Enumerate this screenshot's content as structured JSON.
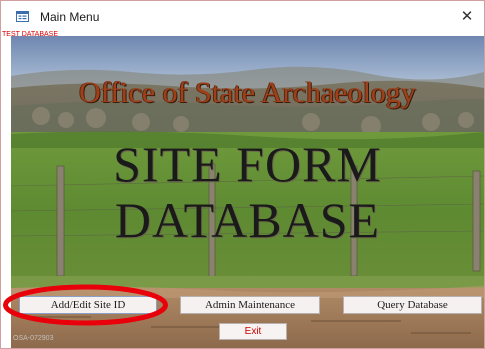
{
  "window": {
    "title": "Main Menu",
    "close_glyph": "✕",
    "icon": "access-form-icon"
  },
  "form": {
    "environment_label": "TEST DATABASE",
    "heading_office": "Office of State Archaeology",
    "heading_line1": "SITE FORM",
    "heading_line2": "DATABASE",
    "version_label": "OSA-072903"
  },
  "buttons": {
    "add_edit": "Add/Edit Site ID",
    "admin": "Admin Maintenance",
    "query": "Query Database",
    "exit": "Exit"
  },
  "annotation": {
    "highlight_color": "#e8000a",
    "target": "Add/Edit Site ID"
  },
  "colors": {
    "office_heading": "#a0401a",
    "exit_text": "#d00000",
    "test_label": "#e00000"
  }
}
